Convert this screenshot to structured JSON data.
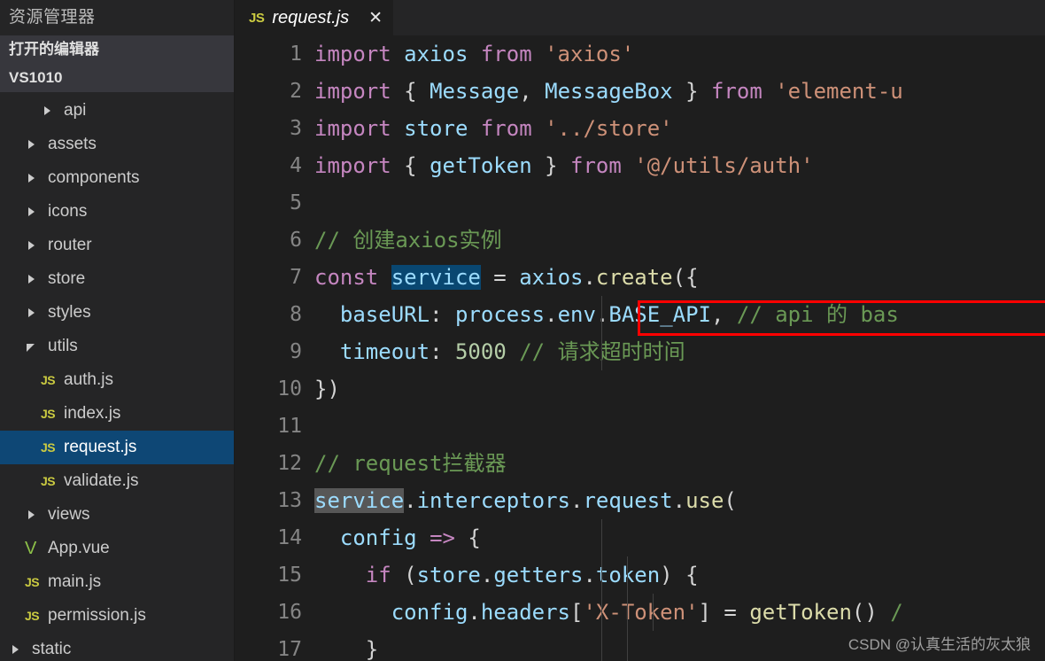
{
  "sidebar": {
    "explorer_title": "资源管理器",
    "open_editors_label": "打开的编辑器",
    "project_label": "VS1010",
    "tree": [
      {
        "label": "api",
        "type": "folder",
        "state": "collapsed",
        "indent": 2,
        "icon": "chevron-right-icon",
        "selected": false
      },
      {
        "label": "assets",
        "type": "folder",
        "state": "collapsed",
        "indent": 1,
        "icon": "chevron-right-icon",
        "selected": false
      },
      {
        "label": "components",
        "type": "folder",
        "state": "collapsed",
        "indent": 1,
        "icon": "chevron-right-icon",
        "selected": false
      },
      {
        "label": "icons",
        "type": "folder",
        "state": "collapsed",
        "indent": 1,
        "icon": "chevron-right-icon",
        "selected": false
      },
      {
        "label": "router",
        "type": "folder",
        "state": "collapsed",
        "indent": 1,
        "icon": "chevron-right-icon",
        "selected": false
      },
      {
        "label": "store",
        "type": "folder",
        "state": "collapsed",
        "indent": 1,
        "icon": "chevron-right-icon",
        "selected": false
      },
      {
        "label": "styles",
        "type": "folder",
        "state": "collapsed",
        "indent": 1,
        "icon": "chevron-right-icon",
        "selected": false
      },
      {
        "label": "utils",
        "type": "folder",
        "state": "expanded",
        "indent": 1,
        "icon": "chevron-down-icon",
        "selected": false
      },
      {
        "label": "auth.js",
        "type": "file",
        "state": "",
        "indent": 2,
        "icon": "js-file-icon",
        "selected": false
      },
      {
        "label": "index.js",
        "type": "file",
        "state": "",
        "indent": 2,
        "icon": "js-file-icon",
        "selected": false
      },
      {
        "label": "request.js",
        "type": "file",
        "state": "",
        "indent": 2,
        "icon": "js-file-icon",
        "selected": true
      },
      {
        "label": "validate.js",
        "type": "file",
        "state": "",
        "indent": 2,
        "icon": "js-file-icon",
        "selected": false
      },
      {
        "label": "views",
        "type": "folder",
        "state": "collapsed",
        "indent": 1,
        "icon": "chevron-right-icon",
        "selected": false
      },
      {
        "label": "App.vue",
        "type": "file",
        "state": "",
        "indent": 1,
        "icon": "vue-file-icon",
        "selected": false
      },
      {
        "label": "main.js",
        "type": "file",
        "state": "",
        "indent": 1,
        "icon": "js-file-icon",
        "selected": false
      },
      {
        "label": "permission.js",
        "type": "file",
        "state": "",
        "indent": 1,
        "icon": "js-file-icon",
        "selected": false
      },
      {
        "label": "static",
        "type": "folder",
        "state": "collapsed",
        "indent": 0,
        "icon": "chevron-right-icon",
        "selected": false
      }
    ]
  },
  "tabs": [
    {
      "icon": "js-file-icon",
      "label": "request.js",
      "close": "✕",
      "active": true,
      "preview": true
    }
  ],
  "editor": {
    "line_numbers": [
      "1",
      "2",
      "3",
      "4",
      "5",
      "6",
      "7",
      "8",
      "9",
      "10",
      "11",
      "12",
      "13",
      "14",
      "15",
      "16",
      "17"
    ],
    "lines": [
      {
        "n": "1",
        "tokens": [
          {
            "t": "import",
            "c": "kw"
          },
          {
            "t": " ",
            "c": "punc"
          },
          {
            "t": "axios",
            "c": "id"
          },
          {
            "t": " ",
            "c": "punc"
          },
          {
            "t": "from",
            "c": "kw"
          },
          {
            "t": " ",
            "c": "punc"
          },
          {
            "t": "'axios'",
            "c": "str"
          }
        ]
      },
      {
        "n": "2",
        "tokens": [
          {
            "t": "import",
            "c": "kw"
          },
          {
            "t": " { ",
            "c": "punc"
          },
          {
            "t": "Message",
            "c": "id"
          },
          {
            "t": ", ",
            "c": "punc"
          },
          {
            "t": "MessageBox",
            "c": "id"
          },
          {
            "t": " } ",
            "c": "punc"
          },
          {
            "t": "from",
            "c": "kw"
          },
          {
            "t": " ",
            "c": "punc"
          },
          {
            "t": "'element-u",
            "c": "str"
          }
        ]
      },
      {
        "n": "3",
        "tokens": [
          {
            "t": "import",
            "c": "kw"
          },
          {
            "t": " ",
            "c": "punc"
          },
          {
            "t": "store",
            "c": "id"
          },
          {
            "t": " ",
            "c": "punc"
          },
          {
            "t": "from",
            "c": "kw"
          },
          {
            "t": " ",
            "c": "punc"
          },
          {
            "t": "'../store'",
            "c": "str"
          }
        ]
      },
      {
        "n": "4",
        "tokens": [
          {
            "t": "import",
            "c": "kw"
          },
          {
            "t": " { ",
            "c": "punc"
          },
          {
            "t": "getToken",
            "c": "id"
          },
          {
            "t": " } ",
            "c": "punc"
          },
          {
            "t": "from",
            "c": "kw"
          },
          {
            "t": " ",
            "c": "punc"
          },
          {
            "t": "'@/utils/auth'",
            "c": "str"
          }
        ]
      },
      {
        "n": "5",
        "tokens": []
      },
      {
        "n": "6",
        "tokens": [
          {
            "t": "// 创建axios实例",
            "c": "com"
          }
        ]
      },
      {
        "n": "7",
        "tokens": [
          {
            "t": "const",
            "c": "kw"
          },
          {
            "t": " ",
            "c": "punc"
          },
          {
            "t": "service",
            "c": "sel"
          },
          {
            "t": " = ",
            "c": "punc"
          },
          {
            "t": "axios",
            "c": "id"
          },
          {
            "t": ".",
            "c": "punc"
          },
          {
            "t": "create",
            "c": "fn"
          },
          {
            "t": "({",
            "c": "punc"
          }
        ]
      },
      {
        "n": "8",
        "tokens": [
          {
            "t": "  ",
            "c": "punc"
          },
          {
            "t": "baseURL",
            "c": "id"
          },
          {
            "t": ": ",
            "c": "punc"
          },
          {
            "t": "process",
            "c": "id"
          },
          {
            "t": ".",
            "c": "punc"
          },
          {
            "t": "env",
            "c": "id"
          },
          {
            "t": ".",
            "c": "punc"
          },
          {
            "t": "BASE_API",
            "c": "id"
          },
          {
            "t": ",",
            "c": "punc"
          },
          {
            "t": " // api 的 bas",
            "c": "com"
          }
        ]
      },
      {
        "n": "9",
        "tokens": [
          {
            "t": "  ",
            "c": "punc"
          },
          {
            "t": "timeout",
            "c": "id"
          },
          {
            "t": ": ",
            "c": "punc"
          },
          {
            "t": "5000",
            "c": "num"
          },
          {
            "t": " ",
            "c": "punc"
          },
          {
            "t": "// 请求超时时间",
            "c": "com"
          }
        ]
      },
      {
        "n": "10",
        "tokens": [
          {
            "t": "})",
            "c": "punc"
          }
        ]
      },
      {
        "n": "11",
        "tokens": []
      },
      {
        "n": "12",
        "tokens": [
          {
            "t": "// request拦截器",
            "c": "com"
          }
        ]
      },
      {
        "n": "13",
        "tokens": [
          {
            "t": "service",
            "c": "id occ"
          },
          {
            "t": ".",
            "c": "punc"
          },
          {
            "t": "interceptors",
            "c": "id"
          },
          {
            "t": ".",
            "c": "punc"
          },
          {
            "t": "request",
            "c": "id"
          },
          {
            "t": ".",
            "c": "punc"
          },
          {
            "t": "use",
            "c": "fn"
          },
          {
            "t": "(",
            "c": "punc"
          }
        ]
      },
      {
        "n": "14",
        "tokens": [
          {
            "t": "  ",
            "c": "punc"
          },
          {
            "t": "config",
            "c": "id"
          },
          {
            "t": " ",
            "c": "punc"
          },
          {
            "t": "=>",
            "c": "kw"
          },
          {
            "t": " {",
            "c": "punc"
          }
        ]
      },
      {
        "n": "15",
        "tokens": [
          {
            "t": "    ",
            "c": "punc"
          },
          {
            "t": "if",
            "c": "kw"
          },
          {
            "t": " (",
            "c": "punc"
          },
          {
            "t": "store",
            "c": "id"
          },
          {
            "t": ".",
            "c": "punc"
          },
          {
            "t": "getters",
            "c": "id"
          },
          {
            "t": ".",
            "c": "punc"
          },
          {
            "t": "token",
            "c": "id"
          },
          {
            "t": ") {",
            "c": "punc"
          }
        ]
      },
      {
        "n": "16",
        "tokens": [
          {
            "t": "      ",
            "c": "punc"
          },
          {
            "t": "config",
            "c": "id"
          },
          {
            "t": ".",
            "c": "punc"
          },
          {
            "t": "headers",
            "c": "id"
          },
          {
            "t": "[",
            "c": "punc"
          },
          {
            "t": "'X-Token'",
            "c": "str"
          },
          {
            "t": "] = ",
            "c": "punc"
          },
          {
            "t": "getToken",
            "c": "fn"
          },
          {
            "t": "()",
            "c": "punc"
          },
          {
            "t": " /",
            "c": "com"
          }
        ]
      },
      {
        "n": "17",
        "tokens": [
          {
            "t": "    }",
            "c": "punc"
          }
        ]
      }
    ]
  },
  "annotation": {
    "type": "red-rectangle",
    "color": "#ff0000",
    "target_text": "baseURL: process.env.BASE_API,"
  },
  "watermark": {
    "text": "CSDN @认真生活的灰太狼"
  },
  "colors": {
    "background": "#1e1e1e",
    "sidebar": "#252526",
    "selection_blue": "#0e4775",
    "keyword": "#c586c0",
    "identifier": "#9cdcfe",
    "string": "#ce9178",
    "comment": "#6a9955",
    "function": "#dcdcaa",
    "number": "#b5cea8",
    "js_icon": "#cbcb41",
    "vue_icon": "#8dc149",
    "annotation": "#ff0000"
  }
}
